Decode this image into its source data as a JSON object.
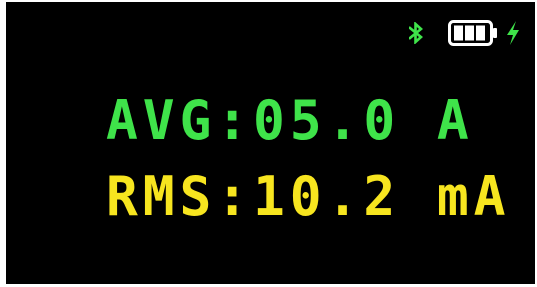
{
  "status_bar": {
    "bluetooth_icon": "bluetooth-icon",
    "battery_icon": "battery-icon",
    "charging_icon": "lightning-bolt-icon",
    "battery_level_bars": 3,
    "battery_level_max": 4,
    "bluetooth_color": "#3fe34a",
    "battery_color": "#ffffff",
    "charging_color": "#3fe34a"
  },
  "readings": {
    "avg": {
      "text": "AVG:05.0 A",
      "color": "#3fe34a"
    },
    "rms": {
      "text": "RMS:10.2 mA",
      "color": "#f7e51f"
    }
  },
  "colors": {
    "screen_background": "#000000",
    "bezel": "#ffffff"
  }
}
